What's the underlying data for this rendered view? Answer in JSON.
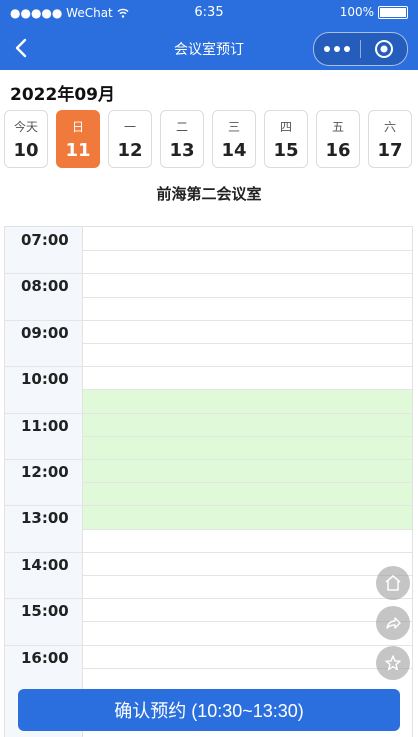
{
  "status_bar": {
    "carrier": "●●●●● WeChat",
    "time": "6:35",
    "battery": "100%"
  },
  "nav": {
    "title": "会议室预订"
  },
  "calendar": {
    "month_label": "2022年09月",
    "days": [
      {
        "weekday": "今天",
        "date": "10",
        "selected": false
      },
      {
        "weekday": "日",
        "date": "11",
        "selected": true
      },
      {
        "weekday": "一",
        "date": "12",
        "selected": false
      },
      {
        "weekday": "二",
        "date": "13",
        "selected": false
      },
      {
        "weekday": "三",
        "date": "14",
        "selected": false
      },
      {
        "weekday": "四",
        "date": "15",
        "selected": false
      },
      {
        "weekday": "五",
        "date": "16",
        "selected": false
      },
      {
        "weekday": "六",
        "date": "17",
        "selected": false
      }
    ]
  },
  "room": {
    "name": "前海第二会议室"
  },
  "schedule": {
    "hours": [
      "07:00",
      "08:00",
      "09:00",
      "10:00",
      "11:00",
      "12:00",
      "13:00",
      "14:00",
      "15:00",
      "16:00"
    ],
    "booked_start": "10:30",
    "booked_end": "13:30"
  },
  "confirm_button": {
    "label": "确认预约 (10:30~13:30)"
  },
  "colors": {
    "primary": "#2b6fde",
    "selected_day": "#f07a3b",
    "booked": "#dff9d9",
    "time_column": "#f4f8fd"
  }
}
